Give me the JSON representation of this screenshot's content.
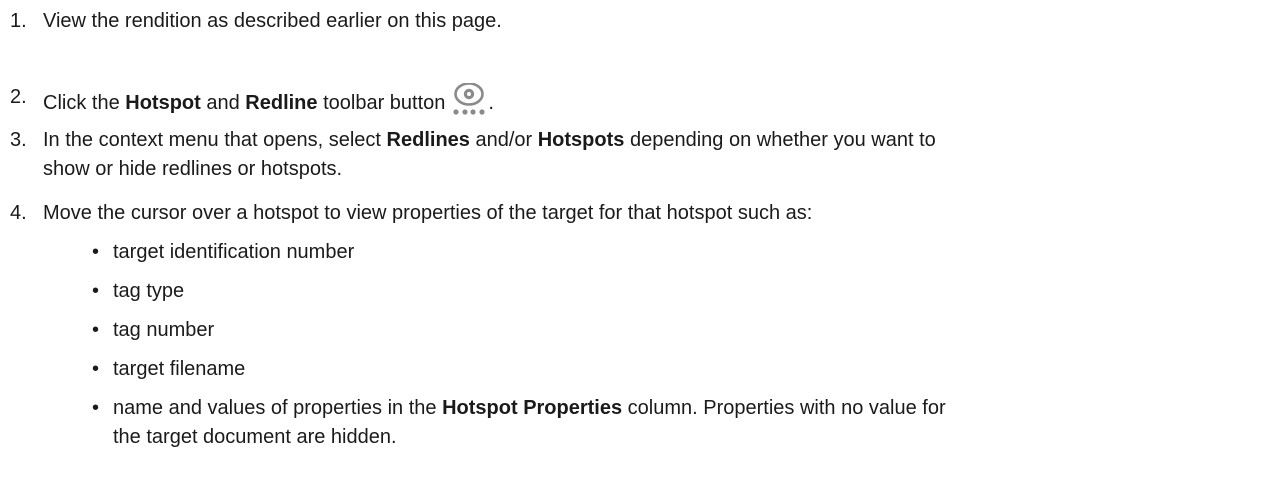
{
  "steps": [
    {
      "num": "1.",
      "segments": [
        {
          "text": "View the rendition as described earlier on this page.",
          "bold": false
        }
      ]
    },
    {
      "num": "2.",
      "segments": [
        {
          "text": "Click the ",
          "bold": false
        },
        {
          "text": "Hotspot",
          "bold": true
        },
        {
          "text": " and ",
          "bold": false
        },
        {
          "text": "Redline",
          "bold": true
        },
        {
          "text": " toolbar button",
          "bold": false
        }
      ],
      "icon": "eye-with-dots-icon",
      "after_icon": "."
    },
    {
      "num": "3.",
      "segments": [
        {
          "text": "In the context menu that opens, select ",
          "bold": false
        },
        {
          "text": "Redlines",
          "bold": true
        },
        {
          "text": " and/or ",
          "bold": false
        },
        {
          "text": "Hotspots",
          "bold": true
        },
        {
          "text": " depending on whether you want to",
          "bold": false
        }
      ],
      "continuation": "show or hide redlines or hotspots."
    },
    {
      "num": "4.",
      "segments": [
        {
          "text": "Move the cursor over a hotspot to view properties of the target for that hotspot such as:",
          "bold": false
        }
      ]
    }
  ],
  "bullets": [
    {
      "text": "target identification number"
    },
    {
      "text": "tag type"
    },
    {
      "text": "tag number"
    },
    {
      "text": "target filename"
    },
    {
      "pre": "name and values of properties in the ",
      "bold": "Hotspot Properties",
      "post": " column. Properties with no value for",
      "continuation": "the target document are hidden."
    }
  ],
  "bullet_char": "•",
  "colors": {
    "text": "#1a1a1a",
    "icon": "#8a8a8a"
  }
}
